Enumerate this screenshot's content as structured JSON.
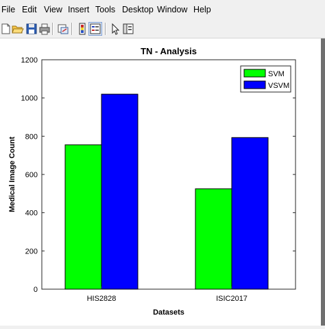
{
  "menu": {
    "items": [
      "File",
      "Edit",
      "View",
      "Insert",
      "Tools",
      "Desktop",
      "Window",
      "Help"
    ]
  },
  "toolbar": {
    "icons": [
      "new-figure-icon",
      "open-file-icon",
      "save-icon",
      "print-icon",
      "link-plot-icon",
      "insert-colorbar-icon",
      "insert-legend-icon",
      "edit-plot-icon",
      "property-editor-icon"
    ]
  },
  "chart_data": {
    "type": "bar",
    "title": "TN - Analysis",
    "xlabel": "Datasets",
    "ylabel": "Medical Image Count",
    "categories": [
      "HIS2828",
      "ISIC2017"
    ],
    "series": [
      {
        "name": "SVM",
        "values": [
          755,
          525
        ],
        "color": "#00ff00"
      },
      {
        "name": "VSVM",
        "values": [
          1020,
          793
        ],
        "color": "#0000ff"
      }
    ],
    "ylim": [
      0,
      1200
    ],
    "yticks": [
      "0",
      "200",
      "400",
      "600",
      "800",
      "1000",
      "1200"
    ],
    "grid": false,
    "legend_position": "top-right"
  }
}
